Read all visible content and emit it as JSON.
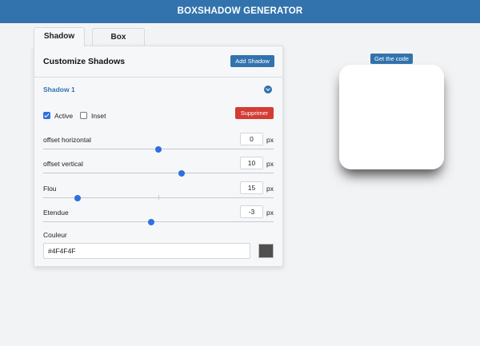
{
  "header": {
    "title": "BOXSHADOW GENERATOR"
  },
  "tabs": [
    {
      "label": "Shadow",
      "active": true
    },
    {
      "label": "Box",
      "active": false
    }
  ],
  "panel": {
    "title": "Customize Shadows",
    "add_shadow_label": "Add Shadow",
    "shadow": {
      "name": "Shadow 1",
      "active_label": "Active",
      "active_checked": true,
      "inset_label": "Inset",
      "inset_checked": false,
      "delete_label": "Supprimer",
      "fields": [
        {
          "label": "offset horizontal",
          "value": "0",
          "unit": "px",
          "min": -50,
          "max": 50
        },
        {
          "label": "offset vertical",
          "value": "10",
          "unit": "px",
          "min": -50,
          "max": 50
        },
        {
          "label": "Flou",
          "value": "15",
          "unit": "px",
          "min": 0,
          "max": 100
        },
        {
          "label": "Etendue",
          "value": "-3",
          "unit": "px",
          "min": -50,
          "max": 50
        }
      ],
      "color_label": "Couleur",
      "color_value": "#4F4F4F"
    }
  },
  "preview": {
    "get_code_label": "Get the code"
  },
  "colors": {
    "brand": "#3273ad",
    "danger": "#d33c33",
    "slider": "#2f6fe0",
    "shadow": "#4F4F4F"
  }
}
